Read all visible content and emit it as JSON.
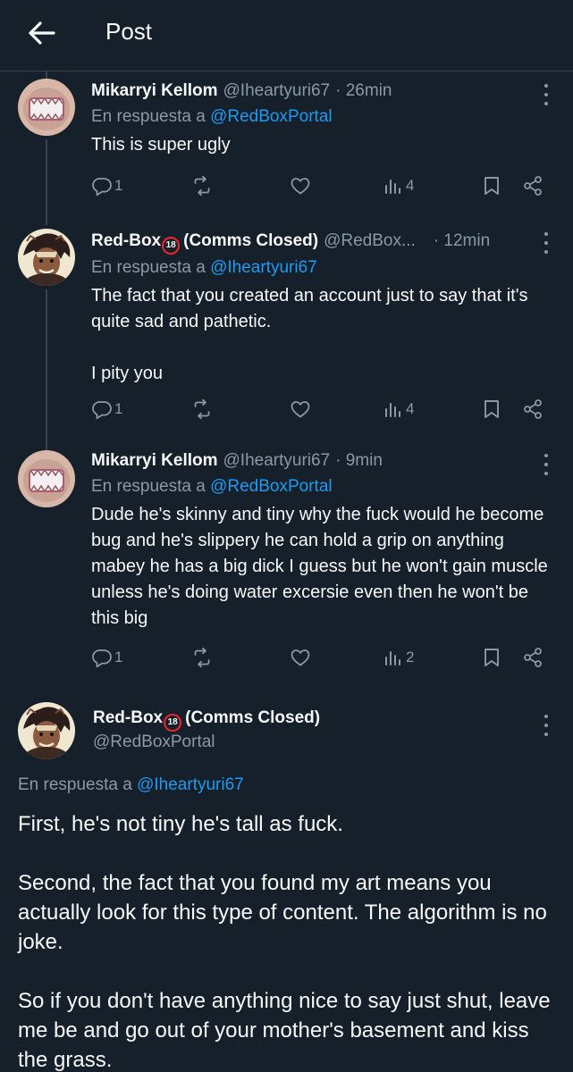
{
  "header": {
    "title": "Post"
  },
  "colors": {
    "background": "#15202b",
    "link": "#1d9bf0",
    "muted": "#8b98a5",
    "badge": "#f4212e"
  },
  "tweets": [
    {
      "name": "Mikarryi Kellom",
      "handle": "@Iheartyuri67",
      "time": "· 26min",
      "reply_prefix": "En respuesta a",
      "reply_handle": "@RedBoxPortal",
      "paragraphs": [
        "This is super ugly"
      ],
      "replies": "1",
      "views": "4",
      "avatar_icon": "domo-avatar"
    },
    {
      "name_prefix": "Red-Box",
      "badge": "18",
      "name_suffix": "(Comms Closed)",
      "handle": "@RedBox...",
      "time": "· 12min",
      "reply_prefix": "En respuesta a",
      "reply_handle": "@Iheartyuri67",
      "paragraphs": [
        "The fact that you created an account just to say that it's quite sad and pathetic.",
        "I pity you"
      ],
      "replies": "1",
      "views": "4",
      "avatar_icon": "redbox-avatar"
    },
    {
      "name": "Mikarryi Kellom",
      "handle": "@Iheartyuri67",
      "time": "· 9min",
      "reply_prefix": "En respuesta a",
      "reply_handle": "@RedBoxPortal",
      "paragraphs": [
        "Dude he's skinny and tiny why the fuck would he become bug and he's slippery he can hold a grip on anything mabey he has a big dick I guess but he won't gain muscle unless he's doing water excersie even then he won't be this big"
      ],
      "replies": "1",
      "views": "2",
      "avatar_icon": "domo-avatar"
    }
  ],
  "main_tweet": {
    "name_prefix": "Red-Box",
    "badge": "18",
    "name_suffix": "(Comms Closed)",
    "handle": "@RedBoxPortal",
    "reply_prefix": "En respuesta a",
    "reply_handle": "@Iheartyuri67",
    "paragraphs": [
      "First, he's not tiny he's tall as fuck.",
      "Second, the fact that you found my art means you actually look for this type of content. The algorithm is no joke.",
      "So if you don't have anything nice to say just shut, leave me be and go out of your mother's basement and kiss the grass."
    ]
  }
}
